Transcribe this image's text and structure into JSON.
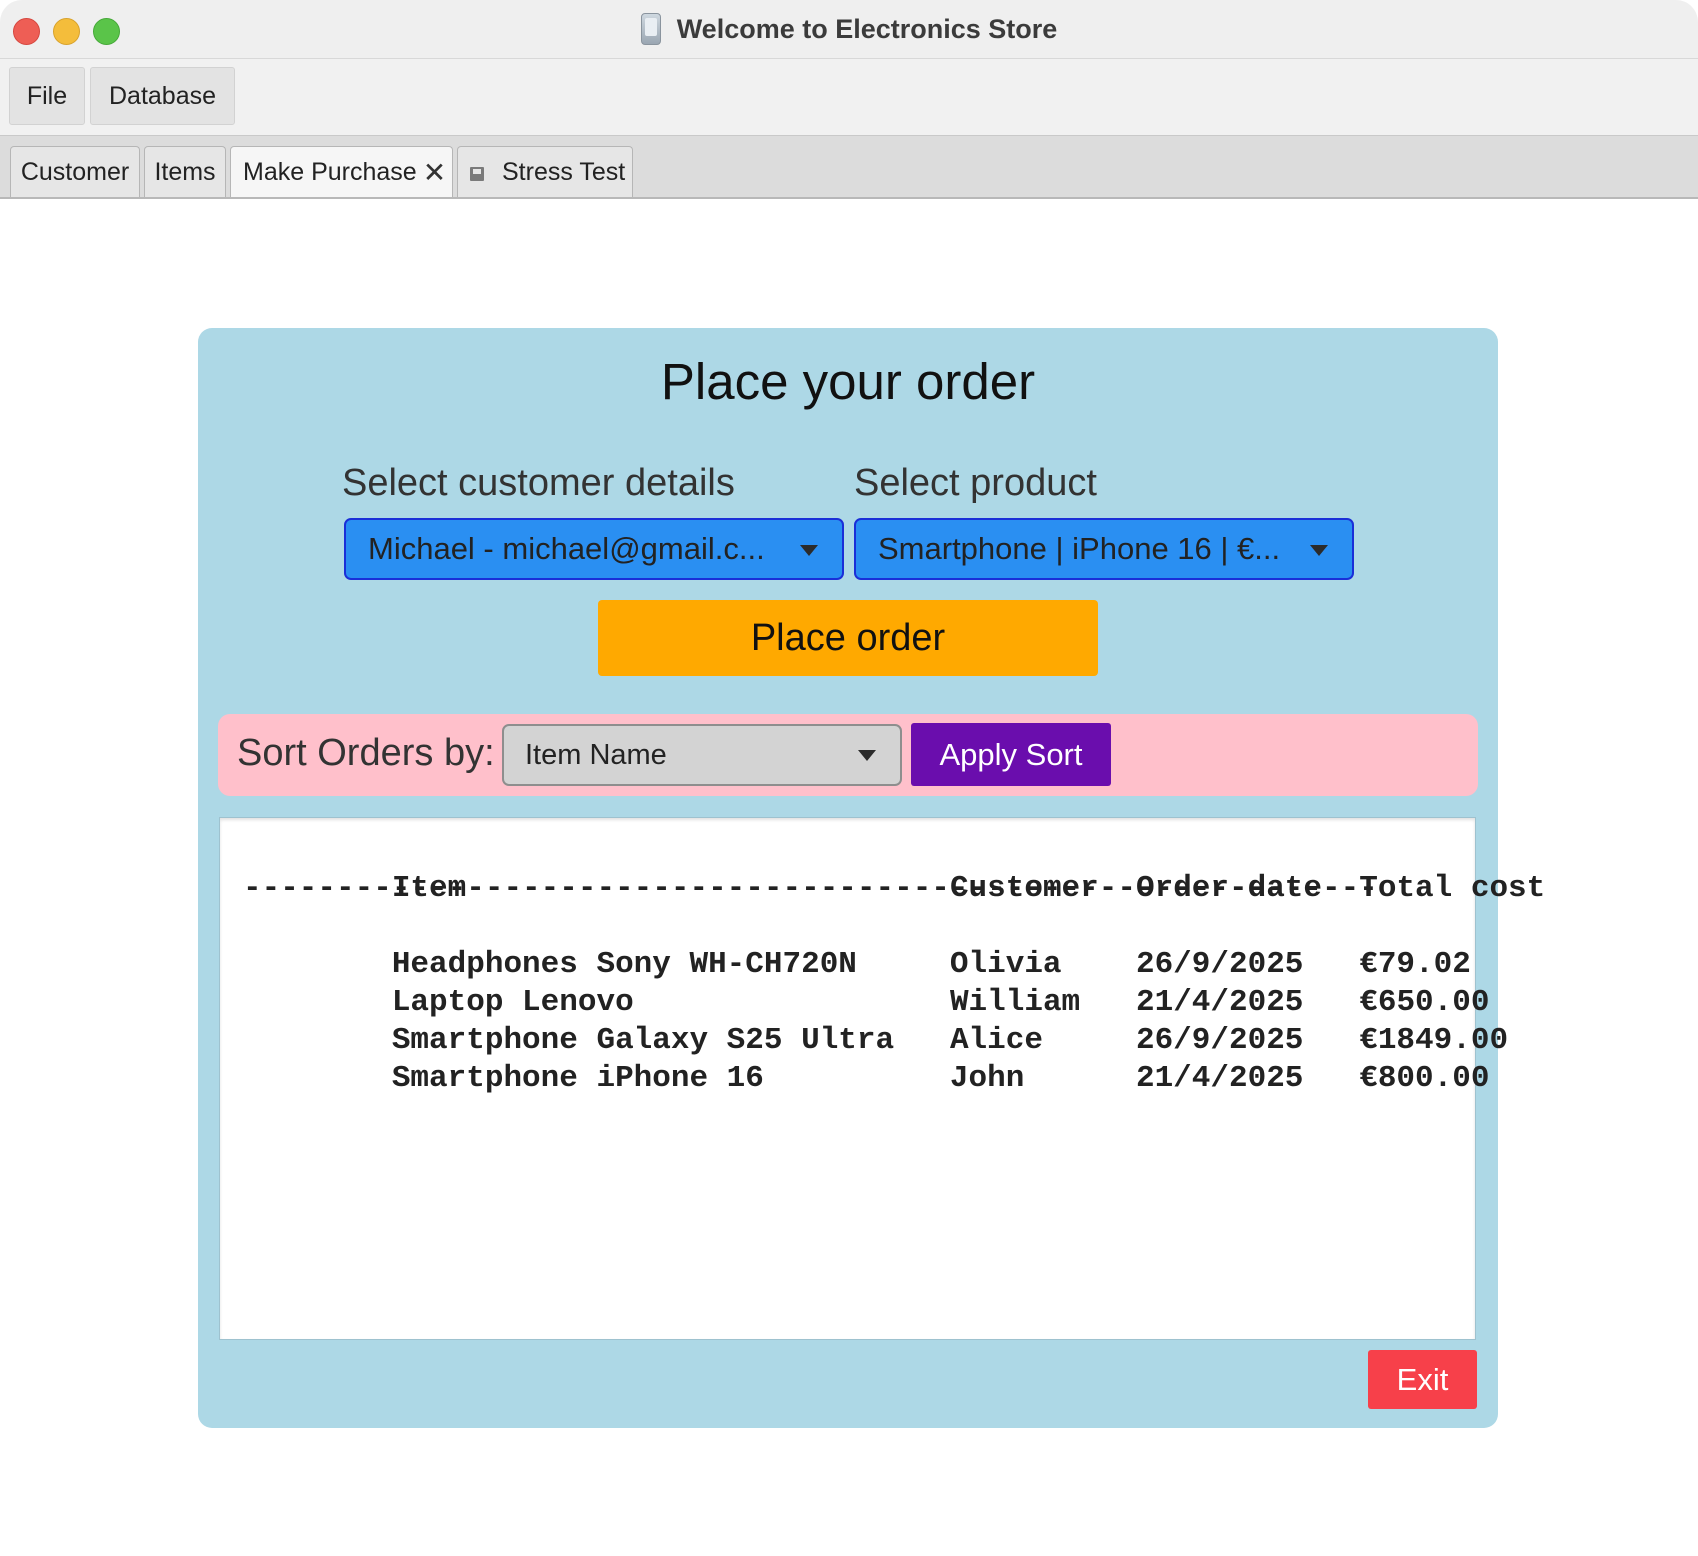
{
  "window": {
    "title": "Welcome to Electronics Store"
  },
  "menubar": {
    "file_label": "File",
    "database_label": "Database"
  },
  "tabs": [
    {
      "label": "Customer"
    },
    {
      "label": "Items"
    },
    {
      "label": "Make Purchase",
      "closable": true,
      "close_glyph": "✕"
    },
    {
      "label": "Stress Test",
      "icon": "floppy-disk-icon"
    }
  ],
  "purchase": {
    "heading": "Place your order",
    "customer_label": "Select customer details",
    "customer_value": "Michael - michael@gmail.c...",
    "product_label": "Select product",
    "product_value": "Smartphone | iPhone 16 | €...",
    "place_order_label": "Place order",
    "sort_label": "Sort Orders by:",
    "sort_value": "Item Name",
    "apply_sort_label": "Apply Sort",
    "exit_label": "Exit"
  },
  "orders": {
    "columns": [
      "Item",
      "Customer",
      "Order date",
      "Total cost"
    ],
    "separator": "-------------------------------------------------------------",
    "rows": [
      [
        "Headphones Sony WH-CH720N",
        "Olivia",
        "26/9/2025",
        "€79.02"
      ],
      [
        "Laptop Lenovo",
        "William",
        "21/4/2025",
        "€650.00"
      ],
      [
        "Smartphone Galaxy S25 Ultra",
        "Alice",
        "26/9/2025",
        "€1849.00"
      ],
      [
        "Smartphone iPhone 16",
        "John",
        "21/4/2025",
        "€800.00"
      ]
    ]
  },
  "colors": {
    "panel_bg": "#add8e6",
    "combo_bg": "#2a8ff2",
    "place_order_bg": "#ffa900",
    "sort_bar_bg": "#ffc0cb",
    "apply_sort_bg": "#6a0dad",
    "exit_bg": "#f7404a"
  }
}
